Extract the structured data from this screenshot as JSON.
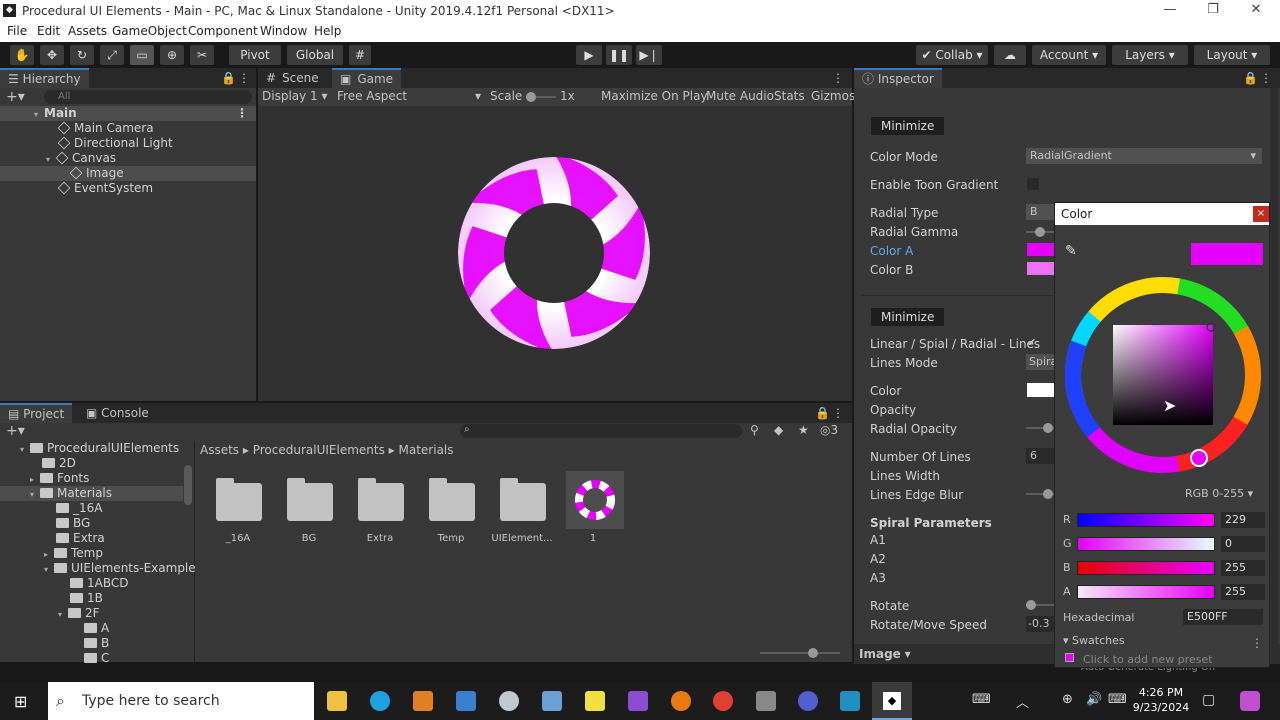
{
  "window": {
    "title": "Procedural UI Elements - Main - PC, Mac & Linux Standalone - Unity 2019.4.12f1 Personal <DX11>"
  },
  "menu": [
    "File",
    "Edit",
    "Assets",
    "GameObject",
    "Component",
    "Window",
    "Help"
  ],
  "toolbar": {
    "pivot": "Pivot",
    "global": "Global",
    "collab": "Collab",
    "account": "Account",
    "layers": "Layers",
    "layout": "Layout"
  },
  "hierarchy": {
    "tab": "Hierarchy",
    "search_placeholder": "All",
    "items": [
      {
        "label": "Main",
        "depth": 0
      },
      {
        "label": "Main Camera",
        "depth": 1
      },
      {
        "label": "Directional Light",
        "depth": 1
      },
      {
        "label": "Canvas",
        "depth": 1
      },
      {
        "label": "Image",
        "depth": 2
      },
      {
        "label": "EventSystem",
        "depth": 1
      }
    ]
  },
  "game": {
    "tabs": [
      "Scene",
      "Game"
    ],
    "display": "Display 1",
    "aspect": "Free Aspect",
    "scale_label": "Scale",
    "scale_value": "1x",
    "maximize": "Maximize On Play",
    "mute": "Mute Audio",
    "stats": "Stats",
    "gizmos": "Gizmos"
  },
  "project": {
    "tabs": [
      "Project",
      "Console"
    ],
    "badge": "3",
    "tree": [
      "ProceduralUIElements",
      "2D",
      "Fonts",
      "Materials",
      "_16A",
      "BG",
      "Extra",
      "Temp",
      "UIElements-Example",
      "1ABCD",
      "1B",
      "2F",
      "A",
      "B",
      "C"
    ],
    "breadcrumb": [
      "Assets",
      "ProceduralUIElements",
      "Materials"
    ],
    "assets": [
      "_16A",
      "BG",
      "Extra",
      "Temp",
      "UIElement...",
      "1"
    ]
  },
  "inspector": {
    "tab": "Inspector",
    "minimize": "Minimize",
    "color_mode_label": "Color Mode",
    "color_mode_value": "RadialGradient",
    "toon": "Enable Toon Gradient",
    "radial_type": "Radial Type",
    "radial_type_value": "B",
    "radial_gamma": "Radial Gamma",
    "color_a": "Color A",
    "color_b": "Color B",
    "lines": "Linear / Spial / Radial - Lines",
    "lines_mode": "Lines Mode",
    "lines_mode_value": "Spira",
    "color": "Color",
    "opacity": "Opacity",
    "radial_opacity": "Radial Opacity",
    "num_lines": "Number Of Lines",
    "num_lines_value": "6",
    "lines_width": "Lines Width",
    "lines_edge_blur": "Lines Edge Blur",
    "spiral": "Spiral Parameters",
    "a1": "A1",
    "a2": "A2",
    "a3": "A3",
    "rotate": "Rotate",
    "rotate_speed": "Rotate/Move Speed",
    "rotate_speed_value": "-0.3",
    "footer": "Image",
    "lighting": "Auto Generate Lighting On"
  },
  "colorpicker": {
    "title": "Color",
    "mode": "RGB 0-255",
    "r_label": "R",
    "r": "229",
    "g_label": "G",
    "g": "0",
    "b_label": "B",
    "b": "255",
    "a_label": "A",
    "a": "255",
    "hex_label": "Hexadecimal",
    "hex": "E500FF",
    "swatches": "Swatches",
    "add_preset": "Click to add new preset",
    "current_color": "#e500ff"
  },
  "taskbar": {
    "search": "Type here to search",
    "time": "4:26 PM",
    "date": "9/23/2024"
  }
}
